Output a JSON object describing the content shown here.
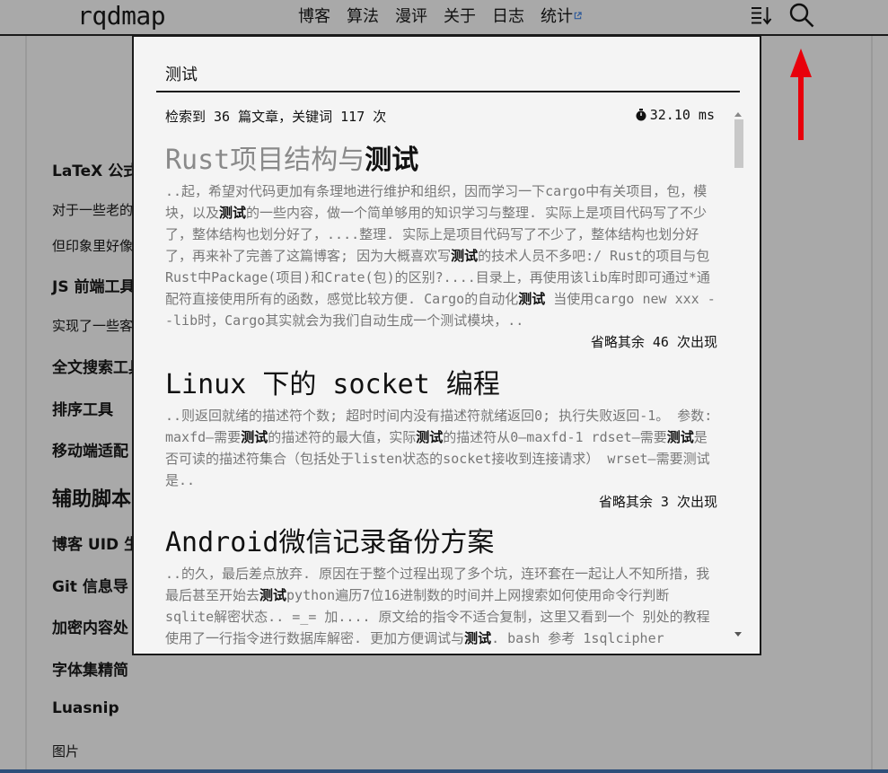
{
  "brand": "rqdmap",
  "nav": {
    "links": [
      "博客",
      "算法",
      "漫评",
      "关于",
      "日志",
      "统计"
    ]
  },
  "icons": {
    "sort": "sort-icon",
    "search": "search-icon",
    "external": "external-link-icon",
    "timer": "timer-icon"
  },
  "annotation_color": "#e8000b",
  "sidebar": [
    {
      "text": "LaTeX 公式",
      "style": "h"
    },
    {
      "text": "对于一些老的",
      "style": "p"
    },
    {
      "text": "但印象里好像",
      "style": "p"
    },
    {
      "text": "JS 前端工具",
      "style": "h"
    },
    {
      "text": "实现了一些客",
      "style": "p"
    },
    {
      "text": "全文搜索工具",
      "style": "h"
    },
    {
      "text": "排序工具",
      "style": "h"
    },
    {
      "text": "移动端适配",
      "style": "h"
    },
    {
      "text": "辅助脚本",
      "style": "big"
    },
    {
      "text": "博客 UID 生",
      "style": "h"
    },
    {
      "text": "Git 信息导",
      "style": "h"
    },
    {
      "text": "加密内容处",
      "style": "h"
    },
    {
      "text": "字体集精简",
      "style": "h"
    },
    {
      "text": "Luasnip",
      "style": "h"
    },
    {
      "text": "图片",
      "style": "p"
    }
  ],
  "search": {
    "query": "测试",
    "summary": "检索到 36 篇文章，关键词 117 次",
    "time": "32.10 ms"
  },
  "results": [
    {
      "title_pre": "Rust项目结构与",
      "title_hit": "测试",
      "visited": true,
      "excerpt": [
        {
          "t": "..起，希望对代码更加有条理地进行维护和组织，因而学习一下cargo中有关项目，包，模块，以及"
        },
        {
          "t": "测试",
          "b": true
        },
        {
          "t": "的一些内容，做一个简单够用的知识学习与整理. 实际上是项目代码写了不少了，整体结构也划分好了，....整理. 实际上是项目代码写了不少了，整体结构也划分好了，再来补了完善了这篇博客; 因为大概喜欢写"
        },
        {
          "t": "测试",
          "b": true
        },
        {
          "t": "的技术人员不多吧:/ Rust的项目与包 Rust中Package(项目)和Crate(包)的区别?....目录上，再使用该lib库时即可通过*通配符直接使用所有的函数，感觉比较方便. Cargo的自动化"
        },
        {
          "t": "测试",
          "b": true
        },
        {
          "t": " 当使用cargo new xxx --lib时，Cargo其实就会为我们自动生成一个测试模块，.."
        }
      ],
      "more": "省略其余 46 次出现"
    },
    {
      "title_pre": "Linux 下的 socket 编程",
      "title_hit": "",
      "visited": false,
      "excerpt": [
        {
          "t": "..则返回就绪的描述符个数; 超时时间内没有描述符就绪返回0; 执行失败返回-1。 参数: maxfd—需要"
        },
        {
          "t": "测试",
          "b": true
        },
        {
          "t": "的描述符的最大值，实际"
        },
        {
          "t": "测试",
          "b": true
        },
        {
          "t": "的描述符从0—maxfd-1 rdset—需要"
        },
        {
          "t": "测试",
          "b": true
        },
        {
          "t": "是否可读的描述符集合（包括处于listen状态的socket接收到连接请求） wrset—需要测试是.."
        }
      ],
      "more": "省略其余 3 次出现"
    },
    {
      "title_pre": "Android微信记录备份方案",
      "title_hit": "",
      "visited": false,
      "excerpt": [
        {
          "t": "..的久，最后差点放弃. 原因在于整个过程出现了多个坑，连环套在一起让人不知所措，我最后甚至开始去"
        },
        {
          "t": "测试",
          "b": true
        },
        {
          "t": "python遍历7位16进制数的时间并上网搜索如何使用命令行判断sqlite解密状态.. =_= 加.... 原文给的指令不适合复制，这里又看到一个 别处的教程使用了一行指令进行数据库解密. 更加方便调试与"
        },
        {
          "t": "测试",
          "b": true
        },
        {
          "t": ". bash 参考 1sqlcipher"
        }
      ],
      "more": ""
    }
  ]
}
